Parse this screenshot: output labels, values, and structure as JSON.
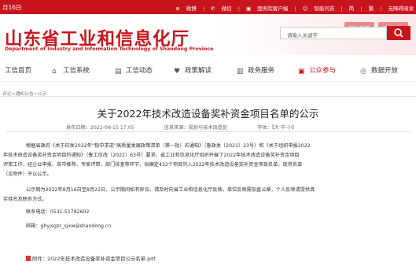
{
  "topbar": {
    "date": "月16日",
    "links": [
      "微博",
      "微信",
      "国务院客户端",
      "智能问答",
      "简",
      "繁",
      "无障碍阅读"
    ]
  },
  "header": {
    "logo_cn": "山东省工业和信息化厅",
    "logo_en": "Department of Industry and Information Technology of Shandong Province",
    "login_label": "网站登录",
    "register_label": "政务服务",
    "search_placeholder": "请输入关键字"
  },
  "nav": {
    "items": [
      "工信首页",
      "工信系统",
      "工信动态",
      "政策解读",
      "政务服务",
      "公众参与",
      "数据开放"
    ]
  },
  "breadcrumb": [
    "评论",
    "通知公告",
    "公示"
  ],
  "article": {
    "title": "关于2022年技术改造设备奖补资金项目名单的公示",
    "publish_time": "发布日期：2022-08-15 17:05",
    "source": "信息来源：规划与技术改造处",
    "font_size": "字体：【大 中 小】",
    "paragraphs": [
      "根据省政府《关于印发2022年“稳中求进”高质量发展政策清单（第一批）的通知》（鲁政发〔2021〕23号）和《关于组织申报2022",
      "年技术改造设备奖补资金项目的通知》（鲁工信改〔2022〕63号）要求，省工业和信息化厅组织开展了2022年技术改造设备奖补资金项目",
      "评审工作，经企业申报、各市推荐、专家评审、部门核查等环节，拟确定432个项目列入2022年技术改造设备奖补资金项目名单，现将名单",
      "（见附件）予以公示。",
      "公示期为2022年8月16日至8月22日，公示期间如有异议，请及时向省工业和信息化厅反映。单位反映需加盖公章，个人反映请提供真",
      "实姓名及联系方式。",
      "联系电话：0531-51782602",
      "邮箱：ghyjsgzc_sjxw@shandong.cn"
    ],
    "attachment": "附件：2022年技术改造设备奖补资金项目公示名单.pdf"
  }
}
